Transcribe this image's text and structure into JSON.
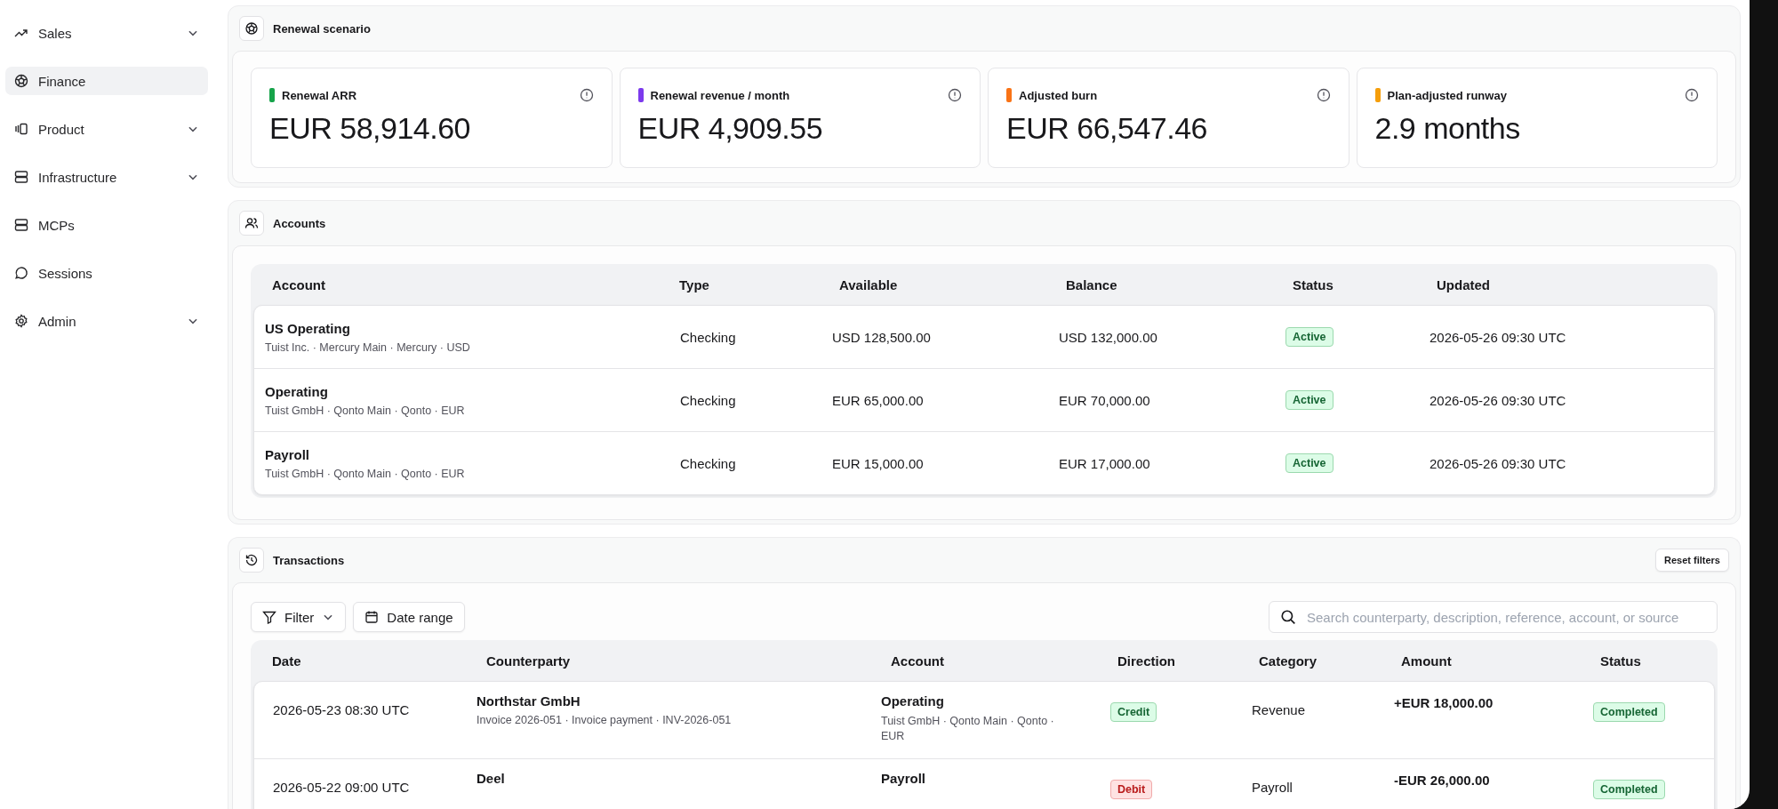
{
  "sidebar": {
    "items": [
      {
        "label": "Sales",
        "selected": false,
        "has_submenu": true
      },
      {
        "label": "Finance",
        "selected": true,
        "has_submenu": false
      },
      {
        "label": "Product",
        "selected": false,
        "has_submenu": true
      },
      {
        "label": "Infrastructure",
        "selected": false,
        "has_submenu": true
      },
      {
        "label": "MCPs",
        "selected": false,
        "has_submenu": false
      },
      {
        "label": "Sessions",
        "selected": false,
        "has_submenu": false
      },
      {
        "label": "Admin",
        "selected": false,
        "has_submenu": true
      }
    ]
  },
  "renewal_scenario": {
    "title": "Renewal scenario",
    "metrics": [
      {
        "label": "Renewal ARR",
        "value": "EUR 58,914.60",
        "color": "#16a34a"
      },
      {
        "label": "Renewal revenue / month",
        "value": "EUR 4,909.55",
        "color": "#7c3aed"
      },
      {
        "label": "Adjusted burn",
        "value": "EUR 66,547.46",
        "color": "#f97316"
      },
      {
        "label": "Plan-adjusted runway",
        "value": "2.9 months",
        "color": "#f59e0b"
      }
    ]
  },
  "accounts": {
    "title": "Accounts",
    "columns": [
      "Account",
      "Type",
      "Available",
      "Balance",
      "Status",
      "Updated"
    ],
    "rows": [
      {
        "name": "US Operating",
        "details": "Tuist Inc. · Mercury Main · Mercury · USD",
        "type": "Checking",
        "available": "USD 128,500.00",
        "balance": "USD 132,000.00",
        "status": {
          "text": "Active",
          "kind": "success"
        },
        "updated": "2026-05-26 09:30 UTC"
      },
      {
        "name": "Operating",
        "details": "Tuist GmbH · Qonto Main · Qonto · EUR",
        "type": "Checking",
        "available": "EUR 65,000.00",
        "balance": "EUR 70,000.00",
        "status": {
          "text": "Active",
          "kind": "success"
        },
        "updated": "2026-05-26 09:30 UTC"
      },
      {
        "name": "Payroll",
        "details": "Tuist GmbH · Qonto Main · Qonto · EUR",
        "type": "Checking",
        "available": "EUR 15,000.00",
        "balance": "EUR 17,000.00",
        "status": {
          "text": "Active",
          "kind": "success"
        },
        "updated": "2026-05-26 09:30 UTC"
      }
    ]
  },
  "transactions": {
    "title": "Transactions",
    "reset_button": "Reset filters",
    "filter_button": "Filter",
    "date_range_button": "Date range",
    "search": {
      "placeholder": "Search counterparty, description, reference, account, or source"
    },
    "columns": [
      "Date",
      "Counterparty",
      "Account",
      "Direction",
      "Category",
      "Amount",
      "Status"
    ],
    "rows": [
      {
        "date": "2026-05-23 08:30 UTC",
        "counterparty": "Northstar GmbH",
        "counterparty_details": "Invoice 2026-051 · Invoice payment · INV-2026-051",
        "account": "Operating",
        "account_details": "Tuist GmbH · Qonto Main · Qonto · EUR",
        "direction": {
          "text": "Credit",
          "kind": "credit"
        },
        "category": "Revenue",
        "amount": "+EUR 18,000.00",
        "status": {
          "text": "Completed",
          "kind": "success"
        }
      },
      {
        "date": "2026-05-22 09:00 UTC",
        "counterparty": "Deel",
        "account": "Payroll",
        "direction": {
          "text": "Debit",
          "kind": "debit"
        },
        "category": "Payroll",
        "amount": "-EUR 26,000.00",
        "status": {
          "text": "Completed",
          "kind": "success"
        }
      }
    ]
  }
}
